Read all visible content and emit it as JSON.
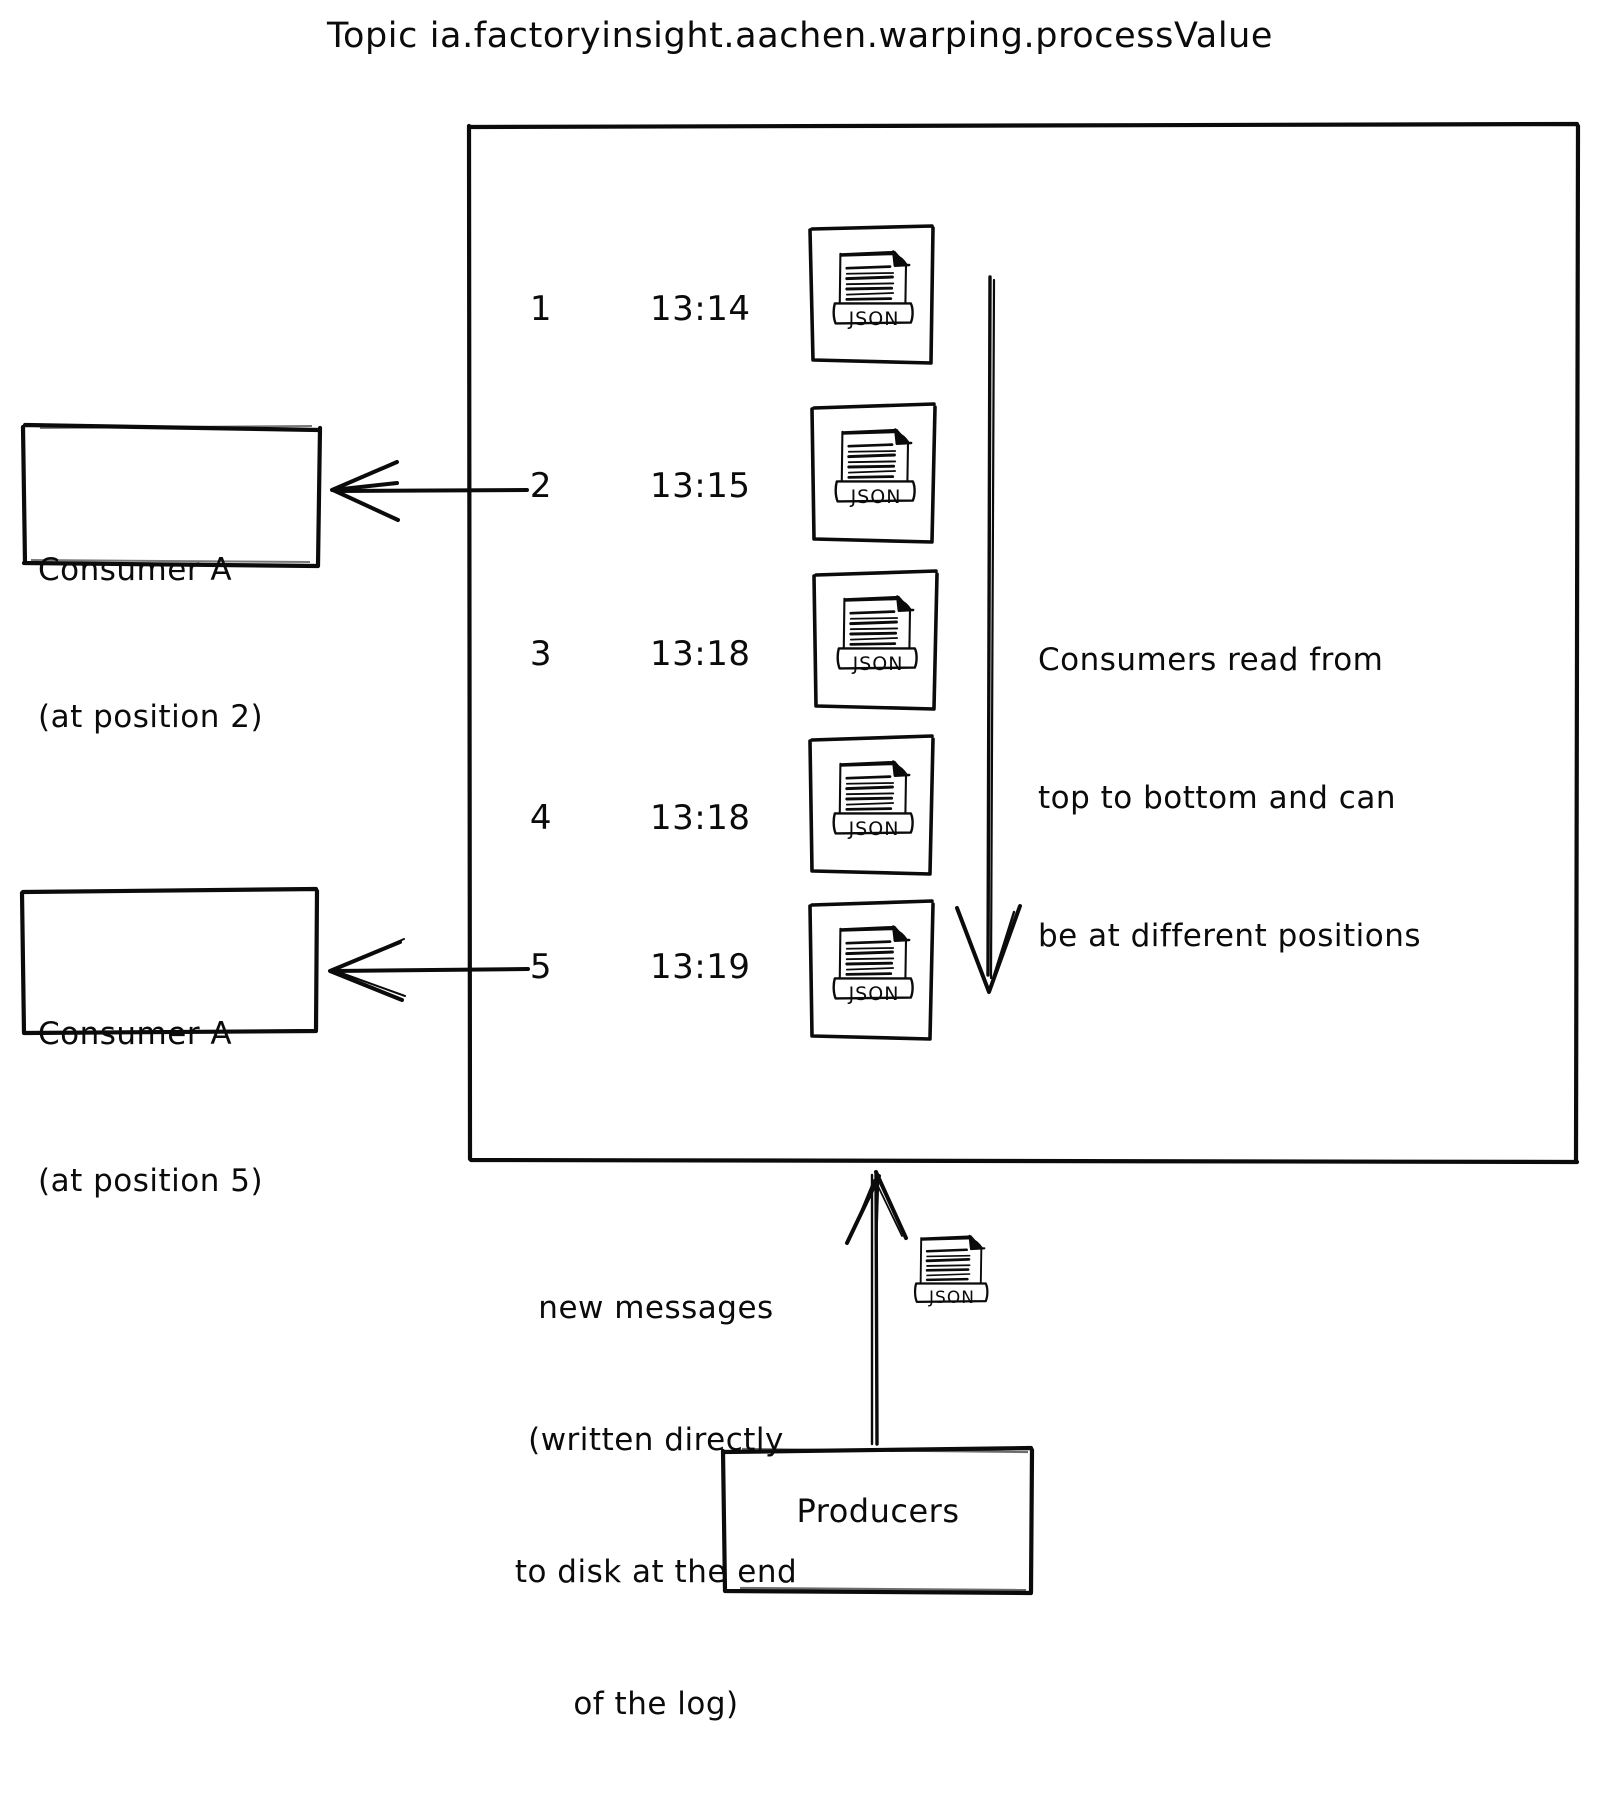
{
  "title": "Topic ia.factoryinsight.aachen.warping.processValue",
  "topic_box": {
    "name": "topic-log"
  },
  "messages": [
    {
      "index": "1",
      "time": "13:14",
      "icon": "json-document-icon"
    },
    {
      "index": "2",
      "time": "13:15",
      "icon": "json-document-icon"
    },
    {
      "index": "3",
      "time": "13:18",
      "icon": "json-document-icon"
    },
    {
      "index": "4",
      "time": "13:18",
      "icon": "json-document-icon"
    },
    {
      "index": "5",
      "time": "13:19",
      "icon": "json-document-icon"
    }
  ],
  "message_icon_label": "JSON",
  "consumers": [
    {
      "name": "Consumer A",
      "position_note": "(at position 2)",
      "points_to_message": "2"
    },
    {
      "name": "Consumer A",
      "position_note": "(at position 5)",
      "points_to_message": "5"
    }
  ],
  "read_direction_note": {
    "line1": "Consumers read from",
    "line2": "top to bottom and can",
    "line3": "be at different positions"
  },
  "new_messages_note": {
    "line1": "new messages",
    "line2": "(written directly",
    "line3": "to disk at the end",
    "line4": "of the log)"
  },
  "producers": {
    "label": "Producers"
  },
  "colors": {
    "ink": "#0b0b0b",
    "background": "#ffffff"
  }
}
